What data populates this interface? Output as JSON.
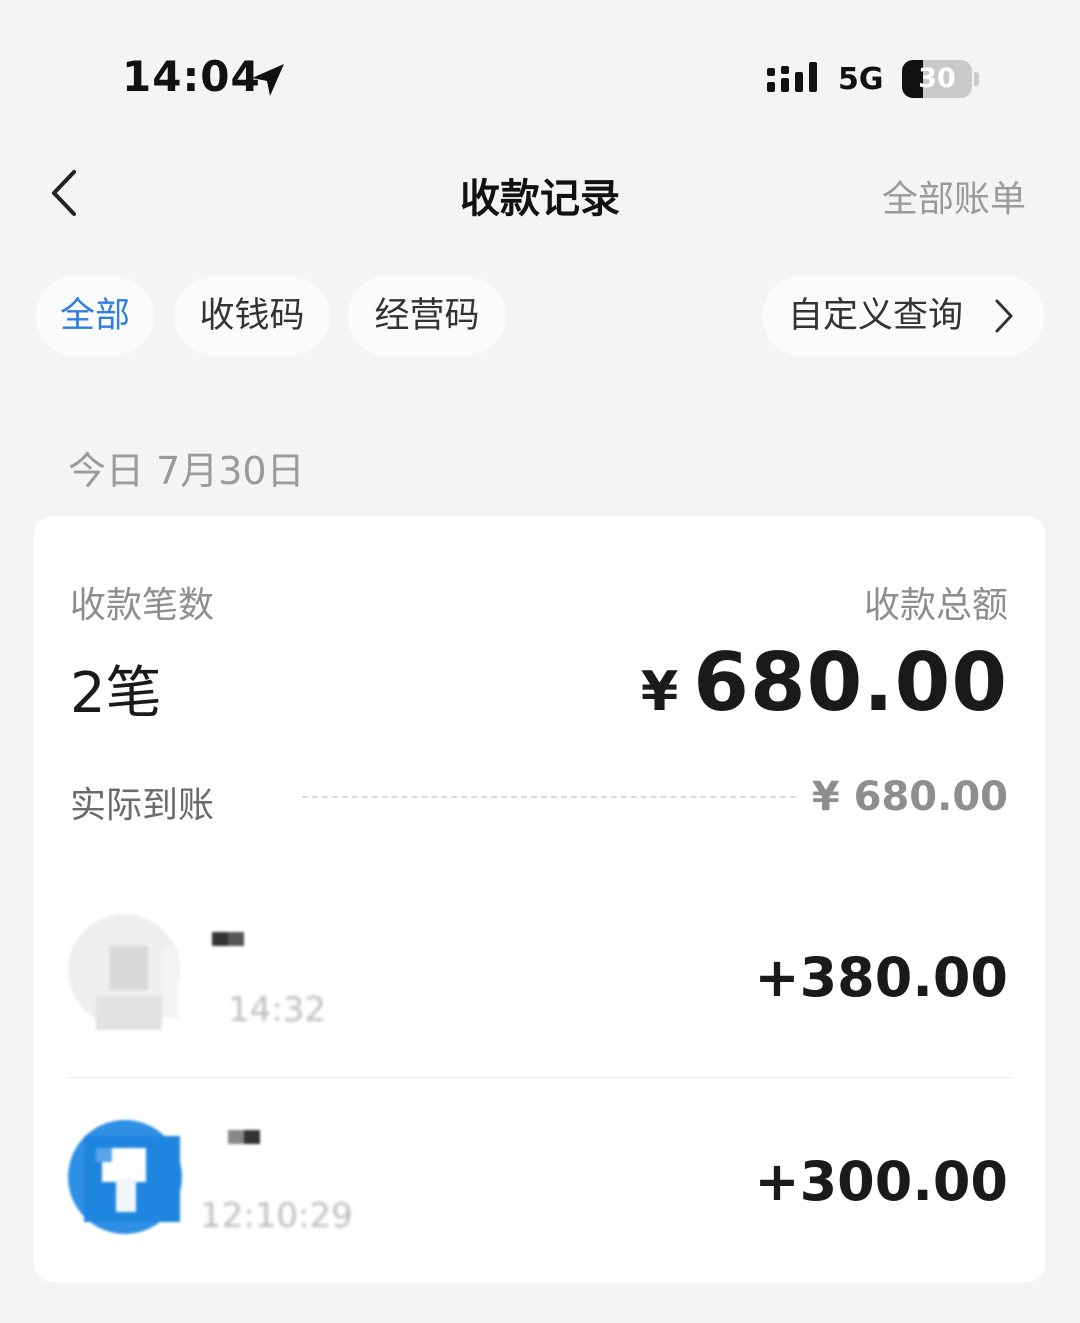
{
  "status_bar": {
    "time": "14:04",
    "network": "5G",
    "battery_level": "30",
    "battery_fraction": 0.3,
    "icons": [
      "location-arrow-icon",
      "signal-icon",
      "battery-icon"
    ]
  },
  "nav": {
    "back_icon": "chevron-left-icon",
    "title": "收款记录",
    "right_link": "全部账单"
  },
  "filters": {
    "tabs": [
      {
        "label": "全部",
        "active": true
      },
      {
        "label": "收钱码",
        "active": false
      },
      {
        "label": "经营码",
        "active": false
      }
    ],
    "custom_query": "自定义查询",
    "custom_query_icon": "chevron-right-icon"
  },
  "date_header": "今日 7月30日",
  "summary": {
    "count_label": "收款笔数",
    "count_value": "2笔",
    "total_label": "收款总额",
    "total_currency": "¥",
    "total_value": "680.00",
    "net_label": "实际到账",
    "net_value": "¥ 680.00"
  },
  "transactions": [
    {
      "name": "",
      "time": "14:32",
      "amount": "+380.00"
    },
    {
      "name": "",
      "time": "12:10:29",
      "amount": "+300.00"
    }
  ],
  "colors": {
    "accent": "#2f7fe0",
    "background": "#f4f4f4",
    "card": "#ffffff",
    "muted_text": "#8e8e8e"
  }
}
